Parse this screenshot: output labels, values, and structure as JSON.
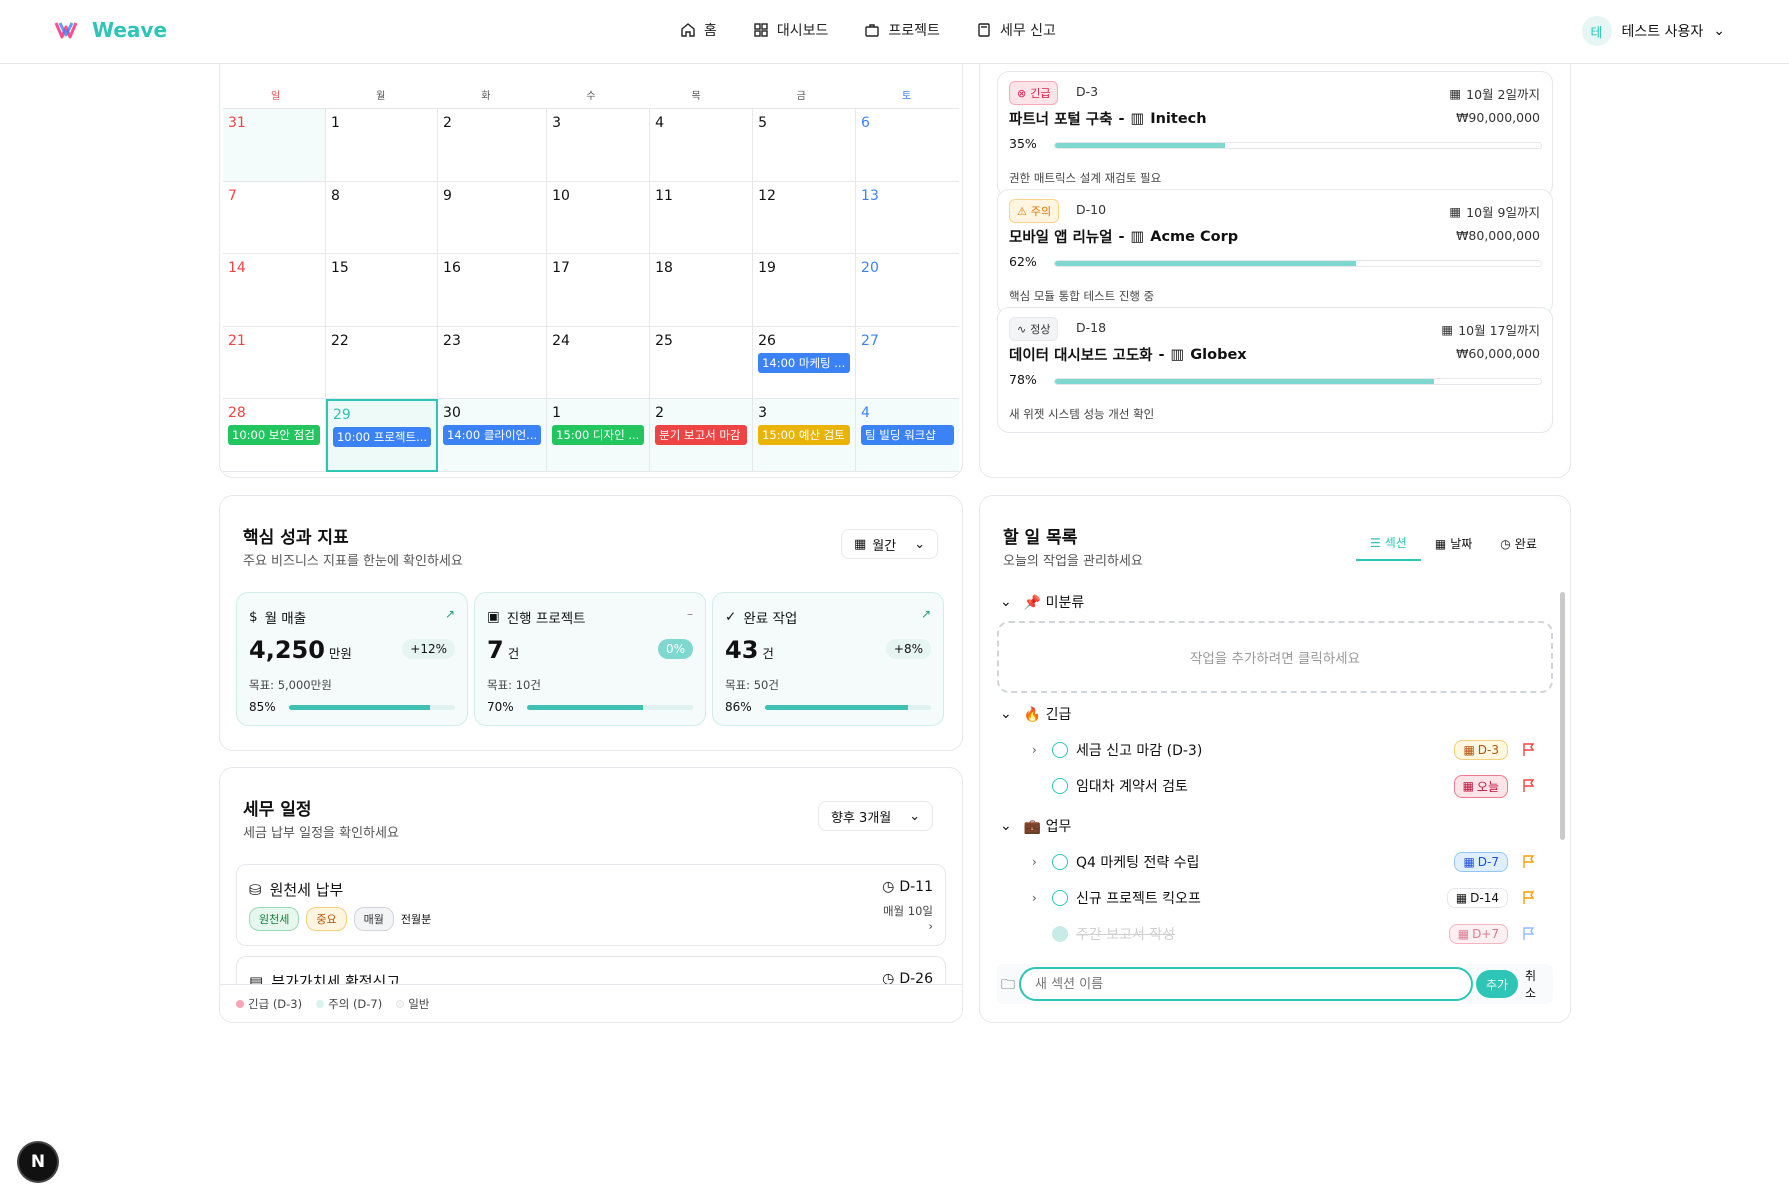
{
  "brand": {
    "name": "Weave",
    "color": "#2ec4b6"
  },
  "nav": [
    {
      "label": "홈",
      "icon": "home-icon"
    },
    {
      "label": "대시보드",
      "icon": "grid-icon"
    },
    {
      "label": "프로젝트",
      "icon": "briefcase-icon"
    },
    {
      "label": "세무 신고",
      "icon": "calculator-icon"
    }
  ],
  "user": {
    "avatar": "테",
    "name": "테스트 사용자"
  },
  "calendar": {
    "weekdays": [
      "일",
      "월",
      "화",
      "수",
      "목",
      "금",
      "토"
    ],
    "weeks": [
      [
        {
          "d": "31"
        },
        {
          "d": "1"
        },
        {
          "d": "2"
        },
        {
          "d": "3"
        },
        {
          "d": "4"
        },
        {
          "d": "5"
        },
        {
          "d": "6"
        }
      ],
      [
        {
          "d": "7"
        },
        {
          "d": "8"
        },
        {
          "d": "9"
        },
        {
          "d": "10"
        },
        {
          "d": "11"
        },
        {
          "d": "12"
        },
        {
          "d": "13"
        }
      ],
      [
        {
          "d": "14"
        },
        {
          "d": "15"
        },
        {
          "d": "16"
        },
        {
          "d": "17"
        },
        {
          "d": "18"
        },
        {
          "d": "19"
        },
        {
          "d": "20"
        }
      ],
      [
        {
          "d": "21"
        },
        {
          "d": "22"
        },
        {
          "d": "23"
        },
        {
          "d": "24"
        },
        {
          "d": "25"
        },
        {
          "d": "26",
          "ev": "14:00 마케팅 ...",
          "c": "#3b82f6"
        },
        {
          "d": "27"
        }
      ],
      [
        {
          "d": "28",
          "ev": "10:00 보안 점검",
          "c": "#22c55e"
        },
        {
          "d": "29",
          "ev": "10:00 프로젝트...",
          "c": "#3b82f6"
        },
        {
          "d": "30",
          "ev": "14:00 클라이언...",
          "c": "#3b82f6"
        },
        {
          "d": "1",
          "ev": "15:00 디자인 ...",
          "c": "#22c55e"
        },
        {
          "d": "2",
          "ev": "분기 보고서 마감",
          "c": "#ef4444"
        },
        {
          "d": "3",
          "ev": "15:00 예산 검토",
          "c": "#eab308"
        },
        {
          "d": "4",
          "ev": "팀 빌딩 워크샵",
          "c": "#3b82f6"
        }
      ]
    ]
  },
  "projects": [
    {
      "status": "긴급",
      "status_icon": "x-circle-icon",
      "dday": "D-3",
      "due": "10월 2일까지",
      "title": "파트너 포털 구축",
      "client": "Initech",
      "budget": "₩90,000,000",
      "progress_label": "35%",
      "progress": 0.35,
      "note": "권한 매트릭스 설계 재검토 필요"
    },
    {
      "status": "주의",
      "status_icon": "warning-icon",
      "dday": "D-10",
      "due": "10월 9일까지",
      "title": "모바일 앱 리뉴얼",
      "client": "Acme Corp",
      "budget": "₩80,000,000",
      "progress_label": "62%",
      "progress": 0.62,
      "note": "핵심 모듈 통합 테스트 진행 중"
    },
    {
      "status": "정상",
      "status_icon": "pulse-icon",
      "dday": "D-18",
      "due": "10월 17일까지",
      "title": "데이터 대시보드 고도화",
      "client": "Globex",
      "budget": "₩60,000,000",
      "progress_label": "78%",
      "progress": 0.78,
      "note": "새 위젯 시스템 성능 개선 확인"
    }
  ],
  "kpi": {
    "title": "핵심 성과 지표",
    "subtitle": "주요 비즈니스 지표를 한눈에 확인하세요",
    "period": "월간",
    "cards": [
      {
        "label": "월 매출",
        "icon": "dollar-icon",
        "trend": "↗",
        "value": "4,250",
        "unit": "만원",
        "change": "+12%",
        "goal": "목표: 5,000만원",
        "pct_label": "85%",
        "pct": 0.85
      },
      {
        "label": "진행 프로젝트",
        "icon": "briefcase-icon",
        "trend": "–",
        "value": "7",
        "unit": "건",
        "change": "0%",
        "goal": "목표: 10건",
        "pct_label": "70%",
        "pct": 0.7
      },
      {
        "label": "완료 작업",
        "icon": "check-circle-icon",
        "trend": "↗",
        "value": "43",
        "unit": "건",
        "change": "+8%",
        "goal": "목표: 50건",
        "pct_label": "86%",
        "pct": 0.86
      }
    ]
  },
  "tax": {
    "title": "세무 일정",
    "subtitle": "세금 납부 일정을 확인하세요",
    "range": "향후 3개월",
    "items": [
      {
        "name": "원천세 납부",
        "dday": "D-11",
        "tags": [
          "원천세",
          "중요",
          "매월"
        ],
        "period": "전월분",
        "date": "매월 10일"
      },
      {
        "name": "부가가치세 확정신고",
        "dday": "D-26"
      }
    ],
    "legend": [
      "긴급 (D-3)",
      "주의 (D-7)",
      "일반"
    ]
  },
  "todo": {
    "title": "할 일 목록",
    "subtitle": "오늘의 작업을 관리하세요",
    "tabs": [
      "섹션",
      "날짜",
      "완료"
    ],
    "groups": [
      {
        "label": "📌 미분류"
      },
      {
        "label": "🔥 긴급"
      },
      {
        "label": "💼 업무"
      }
    ],
    "empty_hint": "작업을 추가하려면 클릭하세요",
    "tasks": [
      {
        "label": "세금 신고 마감 (D-3)",
        "chip": "D-3"
      },
      {
        "label": "임대차 계약서 검토",
        "chip": "오늘"
      },
      {
        "label": "Q4 마케팅 전략 수립",
        "chip": "D-7"
      },
      {
        "label": "신규 프로젝트 킥오프",
        "chip": "D-14"
      },
      {
        "label": "주간 보고서 작성",
        "chip": "D+7"
      }
    ],
    "new_section_placeholder": "새 섹션 이름",
    "add": "추가",
    "cancel": "취소"
  },
  "next_badge": "N"
}
